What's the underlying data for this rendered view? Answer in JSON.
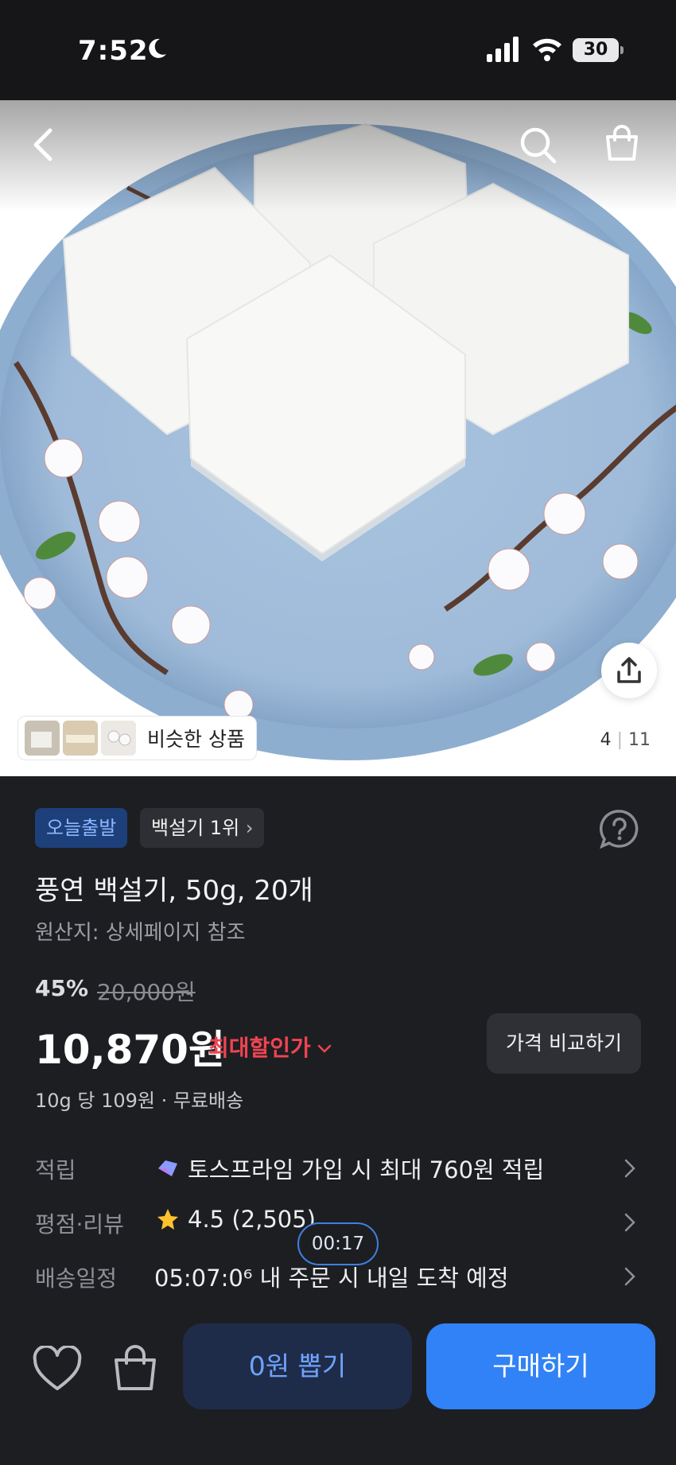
{
  "status": {
    "time": "7:52",
    "battery": "30"
  },
  "hero": {
    "similar_label": "비슷한 상품",
    "counter_current": "4",
    "counter_total": "11"
  },
  "badges": {
    "today_ship": "오늘출발",
    "rank": "백설기 1위"
  },
  "product": {
    "title": "풍연 백설기, 50g, 20개",
    "origin": "원산지: 상세페이지 참조",
    "discount": "45%",
    "original_price": "20,000원",
    "price": "10,870원",
    "max_discount": "최대할인가",
    "compare_button": "가격 비교하기",
    "unit_info": "10g 당 109원 · 무료배송"
  },
  "rows": [
    {
      "key": "적립",
      "value": "토스프라임 가입 시 최대 760원 적립",
      "icon": "prime-gem-icon"
    },
    {
      "key": "평점·리뷰",
      "value": "4.5 (2,505)",
      "icon": "star-icon"
    },
    {
      "key": "배송일정",
      "value": "05:07:0⁶ 내 주문 시 내일 도착 예정"
    }
  ],
  "timer": "00:17",
  "bottom": {
    "draw_button": "0원 뽑기",
    "buy_button": "구매하기"
  },
  "colors": {
    "accent": "#3182f6",
    "danger": "#f04452",
    "background": "#1d1e22"
  }
}
